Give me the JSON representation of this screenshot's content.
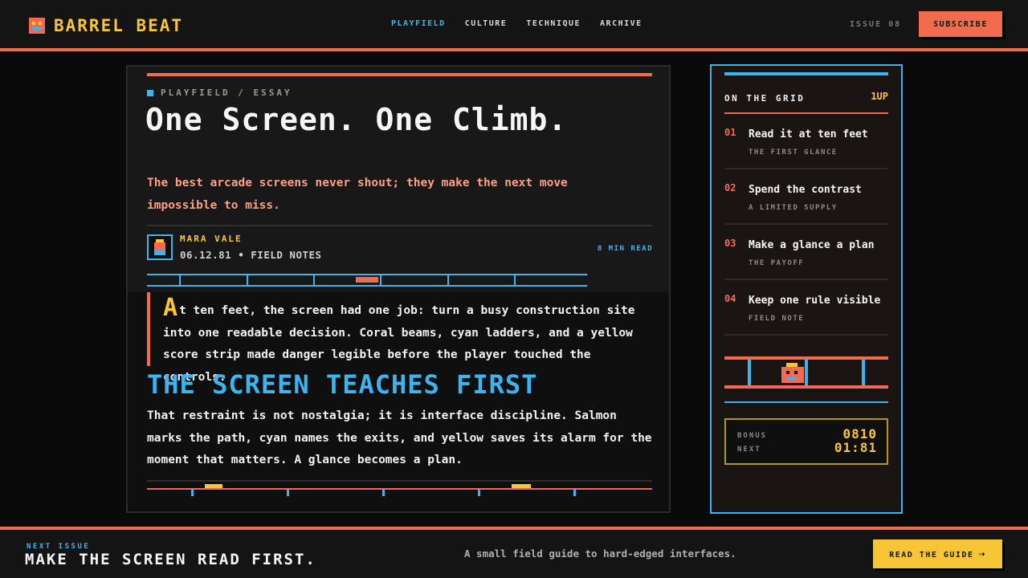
{
  "brand": {
    "name": "BARREL BEAT"
  },
  "nav": {
    "items": [
      "PLAYFIELD",
      "CULTURE",
      "TECHNIQUE",
      "ARCHIVE"
    ],
    "active": "PLAYFIELD"
  },
  "header": {
    "issue": "ISSUE 08",
    "subscribe_label": "SUBSCRIBE"
  },
  "article": {
    "kicker": "PLAYFIELD / ESSAY",
    "headline": "One Screen. One Climb.",
    "dek": "The best arcade screens never shout; they make the next move impossible to miss.",
    "author": "MARA VALE",
    "dateline": "06.12.81  •  FIELD NOTES",
    "readtime": "8 MIN READ",
    "lead_dropcap": "A",
    "lead_rest": "t ten feet, the screen had one job: turn a busy construction site into one readable decision. Coral beams, cyan ladders, and a yellow score strip made danger legible before the player touched the controls.",
    "section_heading": "THE SCREEN TEACHES FIRST",
    "paragraph": "That restraint is not nostalgia; it is interface discipline. Salmon marks the path, cyan names the exits, and yellow saves its alarm for the moment that matters. A glance becomes a plan."
  },
  "sidebar": {
    "title": "ON THE GRID",
    "tag": "1UP",
    "items": [
      {
        "num": "01",
        "title": "Read it at ten feet",
        "sub": "THE FIRST GLANCE"
      },
      {
        "num": "02",
        "title": "Spend the contrast",
        "sub": "A LIMITED SUPPLY"
      },
      {
        "num": "03",
        "title": "Make a glance a plan",
        "sub": "THE PAYOFF"
      },
      {
        "num": "04",
        "title": "Keep one rule visible",
        "sub": "FIELD NOTE"
      }
    ],
    "score": {
      "bonus_label": "BONUS",
      "bonus_value": "0810",
      "next_label": "NEXT",
      "next_value": "01:81"
    }
  },
  "footer": {
    "next_label": "NEXT ISSUE",
    "next_title": "MAKE THE SCREEN READ FIRST.",
    "blurb": "A small field guide to hard-edged interfaces.",
    "cta_label": "READ THE GUIDE",
    "cta_arrow": "⇢"
  },
  "colors": {
    "coral": "#f26b4f",
    "cyan": "#3db4f2",
    "yellow": "#f8c537",
    "background": "#0a0a0a"
  },
  "icons": [
    "brand-logo-icon",
    "author-avatar-icon",
    "arrow-right-icon"
  ]
}
